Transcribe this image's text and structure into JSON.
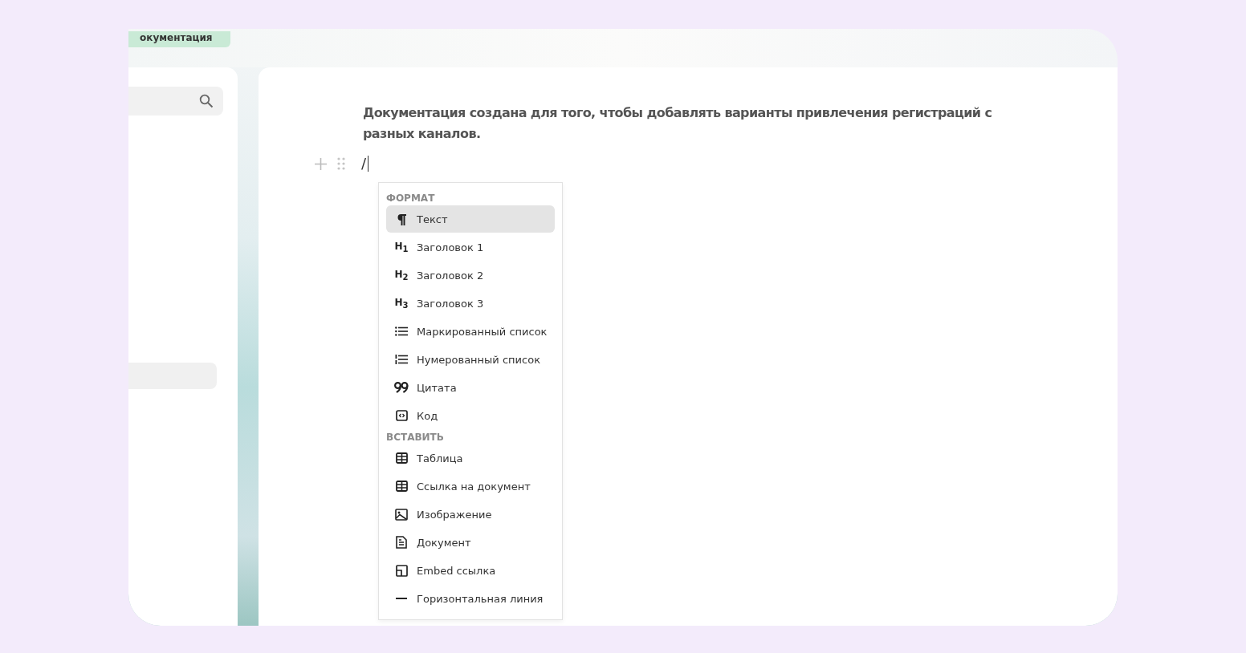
{
  "top_tab": {
    "label": "окументация"
  },
  "sidebar": {
    "items": [
      {
        "selected": true
      }
    ]
  },
  "editor": {
    "paragraph": "Документация создана для того, чтобы добавлять варианты привлечения регистраций с разных каналов.",
    "input": "/"
  },
  "menu": {
    "sections": [
      {
        "title": "ФОРМАТ",
        "items": [
          {
            "kind": "paragraph",
            "label": "Текст",
            "selected": true
          },
          {
            "kind": "heading",
            "glyph": "H$_{1}$",
            "label": "Заголовок 1",
            "selected": false
          },
          {
            "kind": "heading",
            "glyph": "H$_{2}$",
            "label": "Заголовок 2",
            "selected": false
          },
          {
            "kind": "heading",
            "glyph": "H$_{3}$",
            "label": "Заголовок 3",
            "selected": false
          },
          {
            "kind": "bullets",
            "label": "Маркированный список",
            "selected": false
          },
          {
            "kind": "numbers",
            "label": "Нумерованный список",
            "selected": false
          },
          {
            "kind": "quote",
            "label": "Цитата",
            "selected": false
          },
          {
            "kind": "code",
            "label": "Код",
            "selected": false
          }
        ]
      },
      {
        "title": "ВСТАВИТЬ",
        "items": [
          {
            "kind": "table",
            "label": "Таблица",
            "selected": false
          },
          {
            "kind": "table",
            "label": "Ссылка на документ",
            "selected": false
          },
          {
            "kind": "image",
            "label": "Изображение",
            "selected": false
          },
          {
            "kind": "document",
            "label": "Документ",
            "selected": false
          },
          {
            "kind": "embed",
            "label": "Embed ссылка",
            "selected": false
          },
          {
            "kind": "divider",
            "label": "Горизонтальная линия",
            "selected": false
          }
        ]
      }
    ]
  }
}
